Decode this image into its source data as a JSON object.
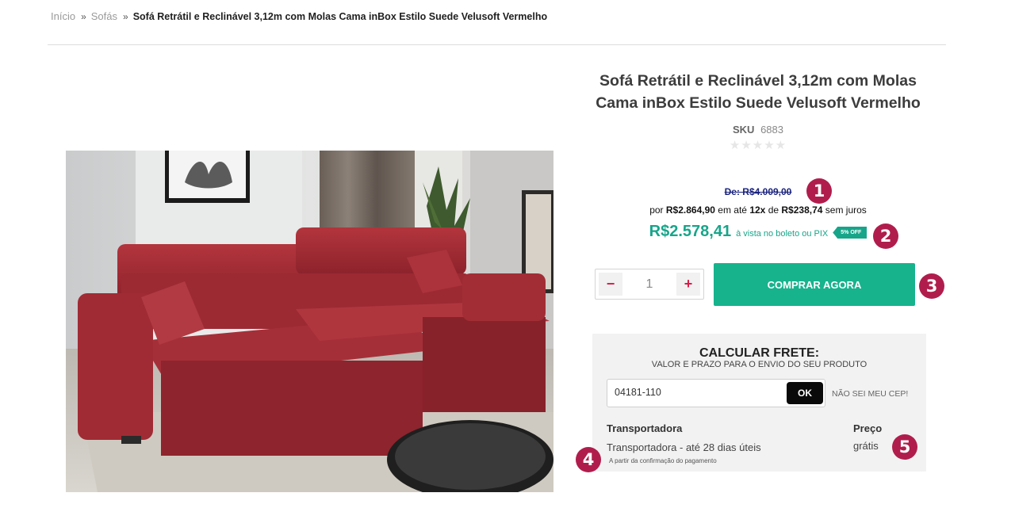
{
  "breadcrumb": {
    "home": "Início",
    "separator": "»",
    "category": "Sofás",
    "current": "Sofá Retrátil e Reclinável 3,12m com Molas Cama inBox Estilo Suede Velusoft Vermelho"
  },
  "product": {
    "title": "Sofá Retrátil e Reclinável 3,12m com Molas Cama inBox Estilo Suede Velusoft Vermelho",
    "sku_label": "SKU",
    "sku_value": "6883",
    "rating_stars": "★★★★★",
    "rating_value": 0,
    "image_icon": "red-retractable-sofa-photo"
  },
  "pricing": {
    "old_price": "De: R$4.009,00",
    "installment_prefix": "por",
    "installment_total": "R$2.864,90",
    "installment_mid1": "em até",
    "installment_count": "12x",
    "installment_mid2": "de",
    "installment_value": "R$238,74",
    "installment_suffix": "sem juros",
    "pix_price": "R$2.578,41",
    "pix_note": "à vista no boleto ou PIX",
    "discount_badge": "5% OFF"
  },
  "purchase": {
    "qty_minus": "−",
    "qty_value": "1",
    "qty_plus": "+",
    "buy_label": "COMPRAR AGORA"
  },
  "freight": {
    "title": "CALCULAR FRETE:",
    "subtitle": "VALOR E PRAZO PARA O ENVIO DO SEU PRODUTO",
    "cep_value": "04181-110",
    "ok_label": "OK",
    "no_cep_label": "NÃO SEI MEU CEP!",
    "col_carrier": "Transportadora",
    "col_price": "Preço",
    "row_carrier": "Transportadora - até 28 dias úteis",
    "row_note": "A partir da confirmação do pagamento",
    "row_price": "grátis"
  },
  "markers": [
    "1",
    "2",
    "3",
    "4",
    "5"
  ],
  "colors": {
    "accent_green": "#17b38d",
    "price_green": "#17a58a",
    "marker_red": "#b01d4d",
    "old_price_blue": "#1a237e",
    "minus_plus_red": "#d61f4a"
  }
}
